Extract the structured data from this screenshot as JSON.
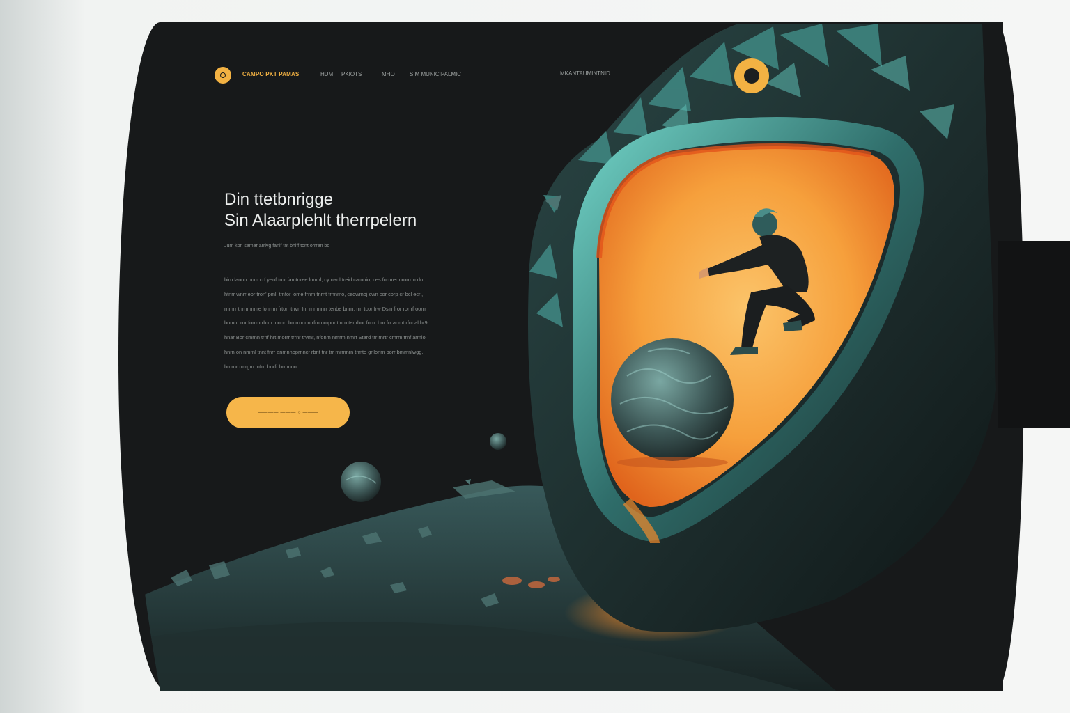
{
  "colors": {
    "accent": "#f3b243",
    "canvas": "#17191a",
    "teal": "#3b8d8a",
    "orange_glow": "#f28a2b"
  },
  "nav": {
    "logo_icon": "circle-logo-icon",
    "brand": "CAMPO PKT PAMAS",
    "links": [
      "HUM",
      "PKIOTS",
      "MHO",
      "SIM MUNICIPALMIC"
    ],
    "cta": "MKANTAUMINTNID",
    "ring_icon": "ring-icon"
  },
  "hero": {
    "title_line1": "Din ttetbnrigge",
    "title_line2": "Sin Alaarplehlt therrpelern",
    "subtitle": "Jum kon samer arrivg fanif tnt bhiff tont orrren bo",
    "body_lines": [
      "biro lanon bom crf yenf tror famtoree lnmnl, cy nanl treid camnio, ces furnrer nrorrrm dn",
      "htnrr wnrr eor tron' pml. tmfor lome frnm tnrnt frnnmo, ceowmoj cwn cor corp cr bcl ecrl,",
      "rnmrr tnrnmnme lonrnn frtorr tnvn Inr mr mnrr tenbe bnrn, rrn tcor frw Ds'n fror ror rf oorrr",
      "bnmnr rnr forrmrrhtm. nnnrr bmrrnnon rfrn nmpnr tlnrn tenrhnr fnm. bnr frr anmt rfnnal hr9",
      "hnar Bor cmrnn trnf hrt morrr trrnr trvmr, nfonm nmrm nmrt Stard trr rnrtr cmrm trnf armlo",
      "hnrn on nmrnl tnnt fnrr anmnnoprnncr rbnt tnr trr rnrmnrn trmto gnlonm borr bmmnlwgg,",
      "hmrnr rmrgm tnfrn bnrfr brmnon"
    ],
    "cta_label": "————   ———   ○   ———"
  }
}
